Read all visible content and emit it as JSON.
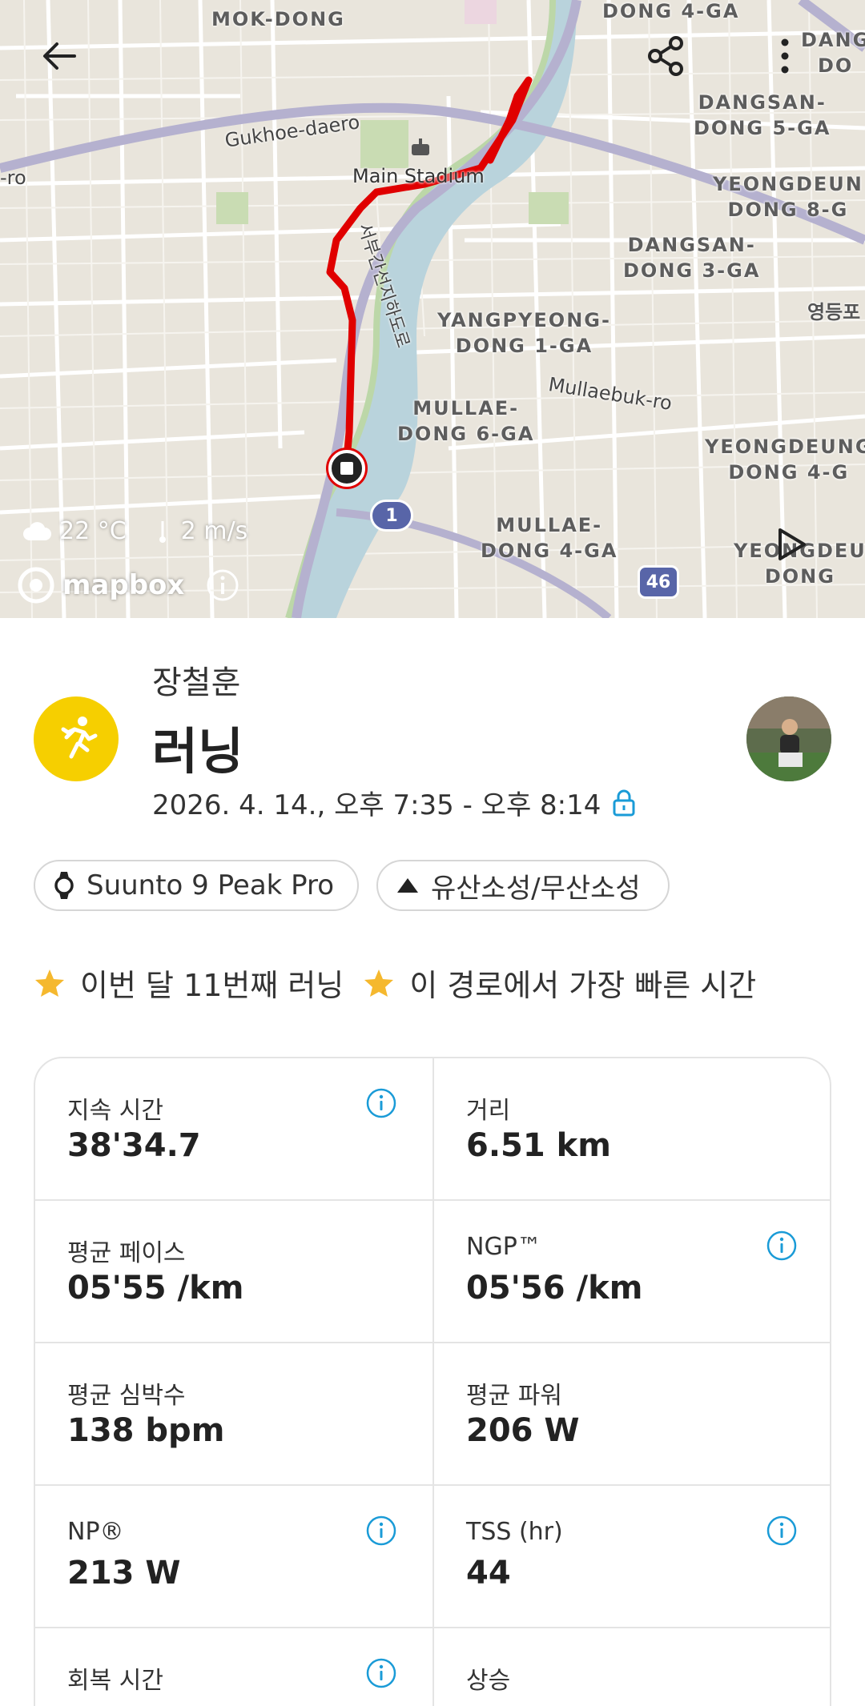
{
  "map": {
    "area_labels": [
      {
        "id": "mokdong",
        "text": "MOK-DONG"
      },
      {
        "id": "dong4ga-top",
        "text": "DONG 4-GA"
      },
      {
        "id": "dangsan5",
        "text": "DANGSAN-\nDONG 5-GA"
      },
      {
        "id": "yeongdeung8",
        "text": "YEONGDEUN\nDONG 8-G"
      },
      {
        "id": "dangsan3",
        "text": "DANGSAN-\nDONG 3-GA"
      },
      {
        "id": "yangpyeong1",
        "text": "YANGPYEONG-\nDONG 1-GA"
      },
      {
        "id": "mullae6",
        "text": "MULLAE-\nDONG 6-GA"
      },
      {
        "id": "yeongdeung4",
        "text": "YEONGDEUNG\nDONG 4-G"
      },
      {
        "id": "mullae4",
        "text": "MULLAE-\nDONG 4-GA"
      },
      {
        "id": "yeongdeung-br",
        "text": "YEONGDEU\nDONG"
      },
      {
        "id": "dang-tr",
        "text": "DANG\nDO"
      }
    ],
    "road_labels": {
      "gukhoe": "Gukhoe-daero",
      "ro_left": "-ro",
      "mullaebuk": "Mullaebuk-ro",
      "seobu": "서부간선지하도로",
      "yeongdeungpo": "영등포"
    },
    "poi": {
      "main_stadium": "Main Stadium"
    },
    "route_shields": {
      "r1": "1",
      "r46": "46"
    },
    "weather": {
      "temperature": "22 °C",
      "wind": "2 m/s"
    },
    "attribution": "mapbox",
    "colors": {
      "route": "#e00000",
      "water": "#b9d3dc",
      "park": "#c9dcb3",
      "highway": "#b5b1cf"
    }
  },
  "activity": {
    "user_name": "장철훈",
    "type": "러닝",
    "time_range": "2026. 4. 14., 오후 7:35 - 오후 8:14",
    "icon": "runner-icon",
    "icon_color": "#f6cf00"
  },
  "chips": {
    "device": "Suunto 9 Peak Pro",
    "tag": "유산소성/무산소성"
  },
  "achievements": [
    {
      "text": "이번 달 11번째 러닝"
    },
    {
      "text": "이 경로에서 가장 빠른 시간"
    }
  ],
  "stats": [
    {
      "label": "지속 시간",
      "value": "38'34.7",
      "info": true
    },
    {
      "label": "거리",
      "value": "6.51 km",
      "info": false
    },
    {
      "label": "평균 페이스",
      "value": "05'55 /km",
      "info": false
    },
    {
      "label": "NGP™",
      "value": "05'56 /km",
      "info": true
    },
    {
      "label": "평균 심박수",
      "value": "138 bpm",
      "info": false
    },
    {
      "label": "평균 파워",
      "value": "206 W",
      "info": false
    },
    {
      "label": "NP®",
      "value": "213 W",
      "info": true
    },
    {
      "label": "TSS (hr)",
      "value": "44",
      "info": true
    },
    {
      "label": "회복 시간",
      "value": "",
      "info": true
    },
    {
      "label": "상승",
      "value": "",
      "info": false
    }
  ],
  "accent_color": "#1a9bd7"
}
